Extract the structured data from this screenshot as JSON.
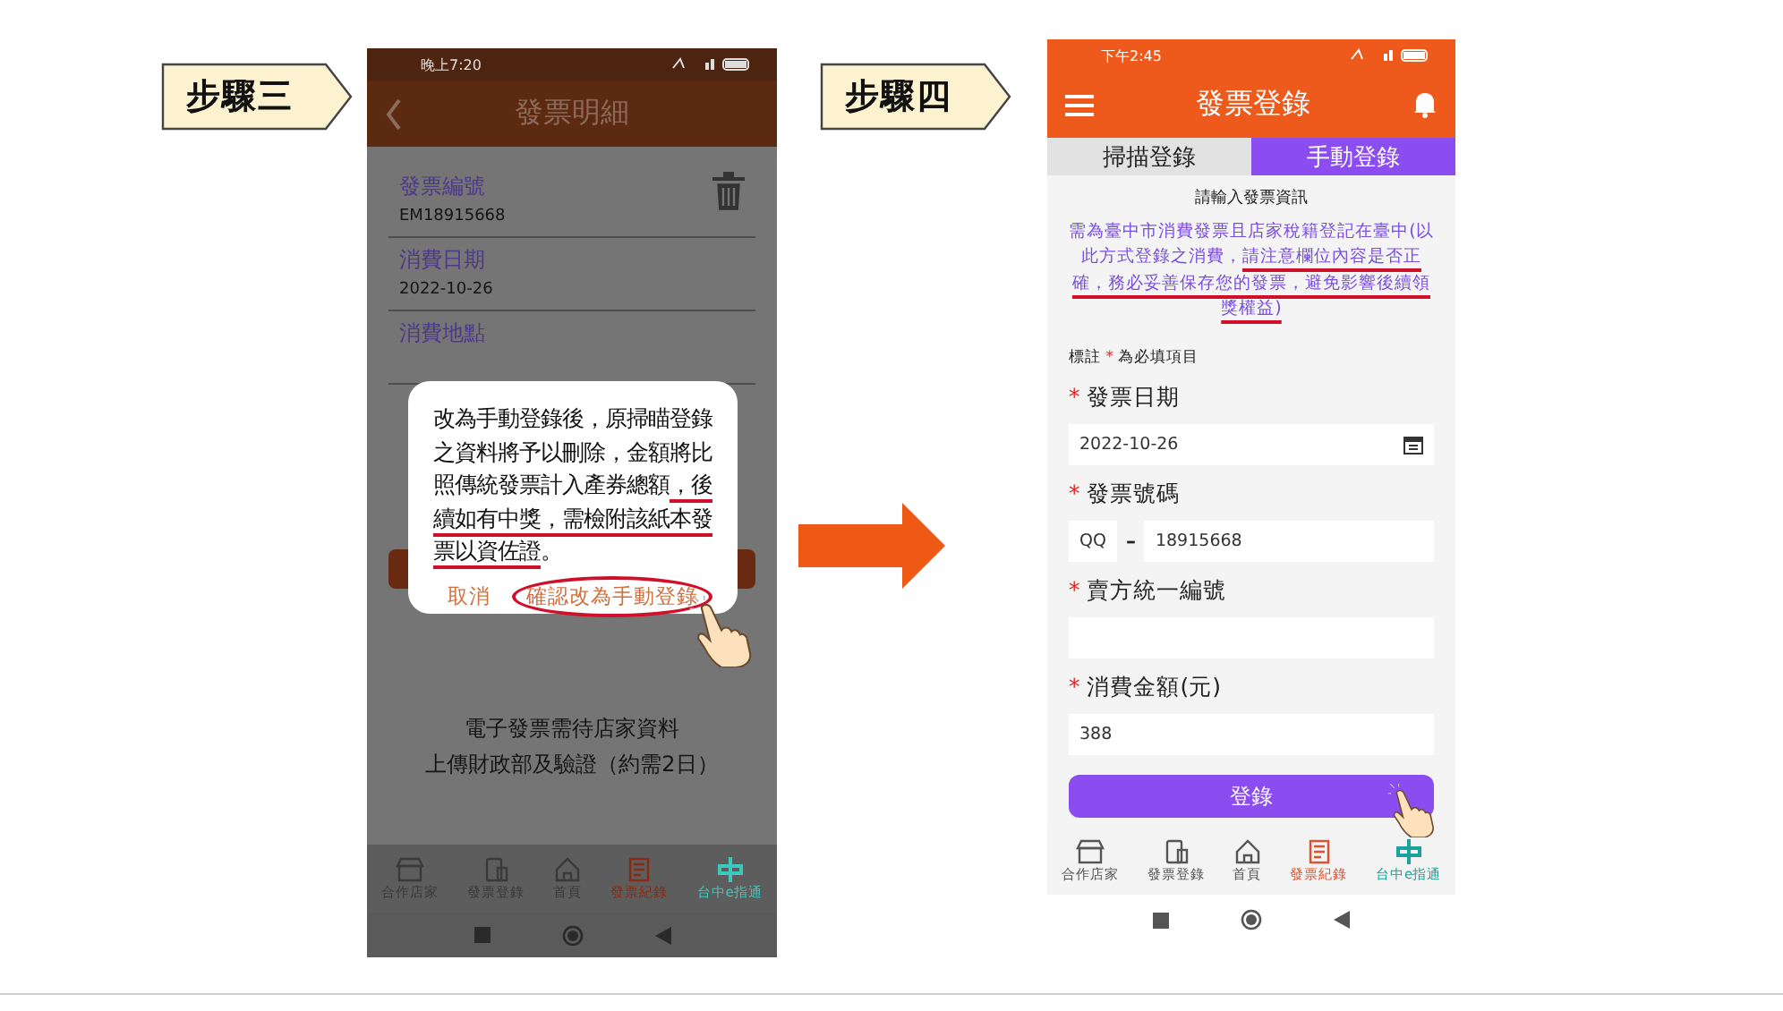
{
  "step_left": {
    "label": "步驟三"
  },
  "detail_screen": {
    "status_bar": {
      "time": "晚上7:20"
    },
    "header": {
      "title": "發票明細"
    },
    "fields": [
      {
        "label": "發票編號",
        "value": "EM18915668",
        "deletable": true
      },
      {
        "label": "消費日期",
        "value": "2022-10-26"
      },
      {
        "label": "消費地點"
      }
    ],
    "dialog": {
      "message_parts": [
        {
          "text": "改為手動登錄後，原掃瞄登錄之資料將予以刪除，金額將比照傳統發票計入產券總額",
          "underlined": false
        },
        {
          "text": "，後續如有中獎，需檢附該紙本發票以資佐證",
          "underlined": true
        },
        {
          "text": "。"
        }
      ],
      "buttons": [
        {
          "label": "取消",
          "circled": false
        },
        {
          "label": "確認改為手動登錄",
          "circled": true
        }
      ]
    },
    "notice_lines": [
      "電子發票需待店家資料",
      "上傳財政部及驗證（約需2日）"
    ],
    "bottom_nav": [
      {
        "label": "合作店家",
        "kind": "store",
        "color": "#3a3a3a"
      },
      {
        "label": "發票登錄",
        "kind": "phone",
        "color": "#3a3a3a"
      },
      {
        "label": "首頁",
        "kind": "home",
        "color": "#3a3a3a"
      },
      {
        "label": "發票紀錄",
        "kind": "receipt",
        "color": "#8a2a10"
      },
      {
        "label": "台中e指通",
        "kind": "logo",
        "color": "#3cc8bc"
      }
    ]
  },
  "step_right": {
    "label": "步驟四"
  },
  "register_screen": {
    "status_bar": {
      "time": "下午2:45"
    },
    "header": {
      "title": "發票登錄"
    },
    "tabs": [
      {
        "label": "掃描登錄",
        "selected": false
      },
      {
        "label": "手動登錄",
        "selected": true
      }
    ],
    "intro": "請輸入發票資訊",
    "notice_parts": [
      {
        "text": "需為臺中市消費發票且店家稅籍登記在臺中(以此方式登錄之消費，",
        "underlined": false
      },
      {
        "text": "請注意欄位內容是否正確，務必妥善保存您的發票，避免影響後續領獎權益)",
        "underlined": true
      }
    ],
    "required_note": {
      "before": "標註",
      "mark": "*",
      "after": "為必填項目"
    },
    "fields": [
      {
        "label": "發票日期",
        "kind": "date",
        "value": "2022-10-26"
      },
      {
        "label": "發票號碼",
        "kind": "number",
        "prefix": "QQ",
        "separator": "–",
        "value": "18915668"
      },
      {
        "label": "賣方統一編號",
        "kind": "text"
      },
      {
        "label": "消費金額(元)",
        "kind": "text",
        "value": "388"
      }
    ],
    "submit": "登錄",
    "bottom_nav": [
      {
        "label": "合作店家",
        "kind": "store",
        "color": "#555555"
      },
      {
        "label": "發票登錄",
        "kind": "phone",
        "color": "#555555"
      },
      {
        "label": "首頁",
        "kind": "home",
        "color": "#555555"
      },
      {
        "label": "發票紀錄",
        "kind": "receipt",
        "color": "#e0502a"
      },
      {
        "label": "台中e指通",
        "kind": "logo",
        "color": "#1aa39a"
      }
    ]
  }
}
